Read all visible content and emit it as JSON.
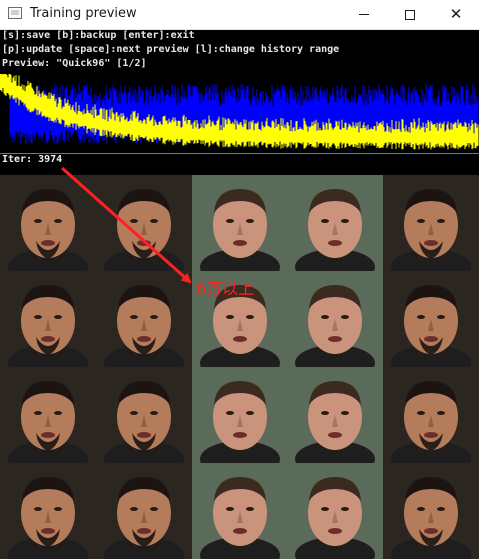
{
  "window": {
    "title": "Training preview",
    "minimize_icon": "minimize-icon",
    "maximize_icon": "maximize-icon",
    "close_icon": "close-icon"
  },
  "preview": {
    "help_line_1": "[s]:save [b]:backup [enter]:exit",
    "help_line_2": "[p]:update [space]:next preview [l]:change history range",
    "preview_line": "Preview: \"Quick96\" [1/2]",
    "iter_line": "Iter: 3974",
    "graph_colors": {
      "src_loss": "#ffff00",
      "dst_loss": "#0000ff",
      "background": "#000000"
    },
    "grid_columns": 5,
    "grid_rows": 4,
    "faces": [
      [
        "Robert Downey Jr.",
        "Robert Downey Jr.",
        "Elon Musk",
        "Elon Musk",
        "Robert Downey Jr."
      ],
      [
        "Robert Downey Jr.",
        "Robert Downey Jr.",
        "Elon Musk",
        "Elon Musk",
        "Robert Downey Jr."
      ],
      [
        "Robert Downey Jr.",
        "Robert Downey Jr.",
        "Elon Musk",
        "Elon Musk",
        "Robert Downey Jr."
      ],
      [
        "Robert Downey Jr.",
        "Robert Downey Jr.",
        "Elon Musk",
        "Elon Musk",
        "Robert Downey Jr."
      ]
    ]
  },
  "annotation": {
    "text": "6万以上",
    "color": "#ff2020"
  }
}
